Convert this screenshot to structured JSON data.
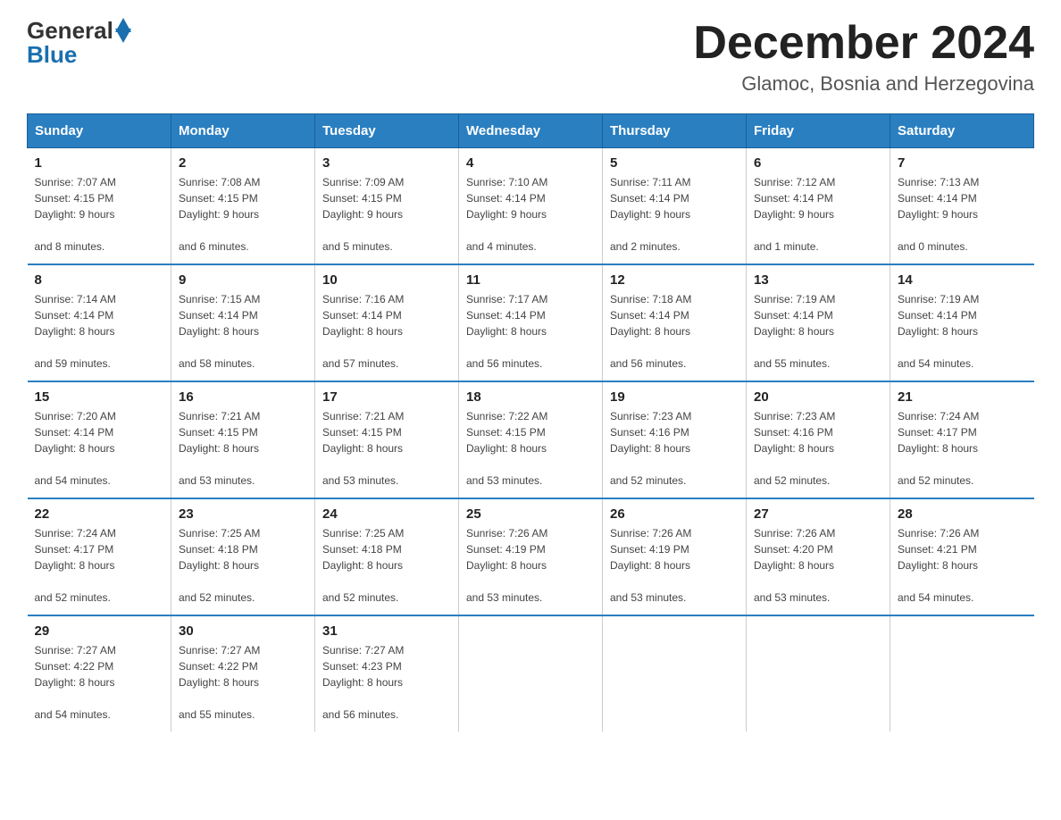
{
  "logo": {
    "general": "General",
    "blue": "Blue"
  },
  "header": {
    "month_year": "December 2024",
    "location": "Glamoc, Bosnia and Herzegovina"
  },
  "weekdays": [
    "Sunday",
    "Monday",
    "Tuesday",
    "Wednesday",
    "Thursday",
    "Friday",
    "Saturday"
  ],
  "weeks": [
    [
      {
        "day": "1",
        "sunrise": "7:07 AM",
        "sunset": "4:15 PM",
        "daylight": "9 hours and 8 minutes."
      },
      {
        "day": "2",
        "sunrise": "7:08 AM",
        "sunset": "4:15 PM",
        "daylight": "9 hours and 6 minutes."
      },
      {
        "day": "3",
        "sunrise": "7:09 AM",
        "sunset": "4:15 PM",
        "daylight": "9 hours and 5 minutes."
      },
      {
        "day": "4",
        "sunrise": "7:10 AM",
        "sunset": "4:14 PM",
        "daylight": "9 hours and 4 minutes."
      },
      {
        "day": "5",
        "sunrise": "7:11 AM",
        "sunset": "4:14 PM",
        "daylight": "9 hours and 2 minutes."
      },
      {
        "day": "6",
        "sunrise": "7:12 AM",
        "sunset": "4:14 PM",
        "daylight": "9 hours and 1 minute."
      },
      {
        "day": "7",
        "sunrise": "7:13 AM",
        "sunset": "4:14 PM",
        "daylight": "9 hours and 0 minutes."
      }
    ],
    [
      {
        "day": "8",
        "sunrise": "7:14 AM",
        "sunset": "4:14 PM",
        "daylight": "8 hours and 59 minutes."
      },
      {
        "day": "9",
        "sunrise": "7:15 AM",
        "sunset": "4:14 PM",
        "daylight": "8 hours and 58 minutes."
      },
      {
        "day": "10",
        "sunrise": "7:16 AM",
        "sunset": "4:14 PM",
        "daylight": "8 hours and 57 minutes."
      },
      {
        "day": "11",
        "sunrise": "7:17 AM",
        "sunset": "4:14 PM",
        "daylight": "8 hours and 56 minutes."
      },
      {
        "day": "12",
        "sunrise": "7:18 AM",
        "sunset": "4:14 PM",
        "daylight": "8 hours and 56 minutes."
      },
      {
        "day": "13",
        "sunrise": "7:19 AM",
        "sunset": "4:14 PM",
        "daylight": "8 hours and 55 minutes."
      },
      {
        "day": "14",
        "sunrise": "7:19 AM",
        "sunset": "4:14 PM",
        "daylight": "8 hours and 54 minutes."
      }
    ],
    [
      {
        "day": "15",
        "sunrise": "7:20 AM",
        "sunset": "4:14 PM",
        "daylight": "8 hours and 54 minutes."
      },
      {
        "day": "16",
        "sunrise": "7:21 AM",
        "sunset": "4:15 PM",
        "daylight": "8 hours and 53 minutes."
      },
      {
        "day": "17",
        "sunrise": "7:21 AM",
        "sunset": "4:15 PM",
        "daylight": "8 hours and 53 minutes."
      },
      {
        "day": "18",
        "sunrise": "7:22 AM",
        "sunset": "4:15 PM",
        "daylight": "8 hours and 53 minutes."
      },
      {
        "day": "19",
        "sunrise": "7:23 AM",
        "sunset": "4:16 PM",
        "daylight": "8 hours and 52 minutes."
      },
      {
        "day": "20",
        "sunrise": "7:23 AM",
        "sunset": "4:16 PM",
        "daylight": "8 hours and 52 minutes."
      },
      {
        "day": "21",
        "sunrise": "7:24 AM",
        "sunset": "4:17 PM",
        "daylight": "8 hours and 52 minutes."
      }
    ],
    [
      {
        "day": "22",
        "sunrise": "7:24 AM",
        "sunset": "4:17 PM",
        "daylight": "8 hours and 52 minutes."
      },
      {
        "day": "23",
        "sunrise": "7:25 AM",
        "sunset": "4:18 PM",
        "daylight": "8 hours and 52 minutes."
      },
      {
        "day": "24",
        "sunrise": "7:25 AM",
        "sunset": "4:18 PM",
        "daylight": "8 hours and 52 minutes."
      },
      {
        "day": "25",
        "sunrise": "7:26 AM",
        "sunset": "4:19 PM",
        "daylight": "8 hours and 53 minutes."
      },
      {
        "day": "26",
        "sunrise": "7:26 AM",
        "sunset": "4:19 PM",
        "daylight": "8 hours and 53 minutes."
      },
      {
        "day": "27",
        "sunrise": "7:26 AM",
        "sunset": "4:20 PM",
        "daylight": "8 hours and 53 minutes."
      },
      {
        "day": "28",
        "sunrise": "7:26 AM",
        "sunset": "4:21 PM",
        "daylight": "8 hours and 54 minutes."
      }
    ],
    [
      {
        "day": "29",
        "sunrise": "7:27 AM",
        "sunset": "4:22 PM",
        "daylight": "8 hours and 54 minutes."
      },
      {
        "day": "30",
        "sunrise": "7:27 AM",
        "sunset": "4:22 PM",
        "daylight": "8 hours and 55 minutes."
      },
      {
        "day": "31",
        "sunrise": "7:27 AM",
        "sunset": "4:23 PM",
        "daylight": "8 hours and 56 minutes."
      },
      null,
      null,
      null,
      null
    ]
  ],
  "labels": {
    "sunrise": "Sunrise:",
    "sunset": "Sunset:",
    "daylight": "Daylight:"
  }
}
